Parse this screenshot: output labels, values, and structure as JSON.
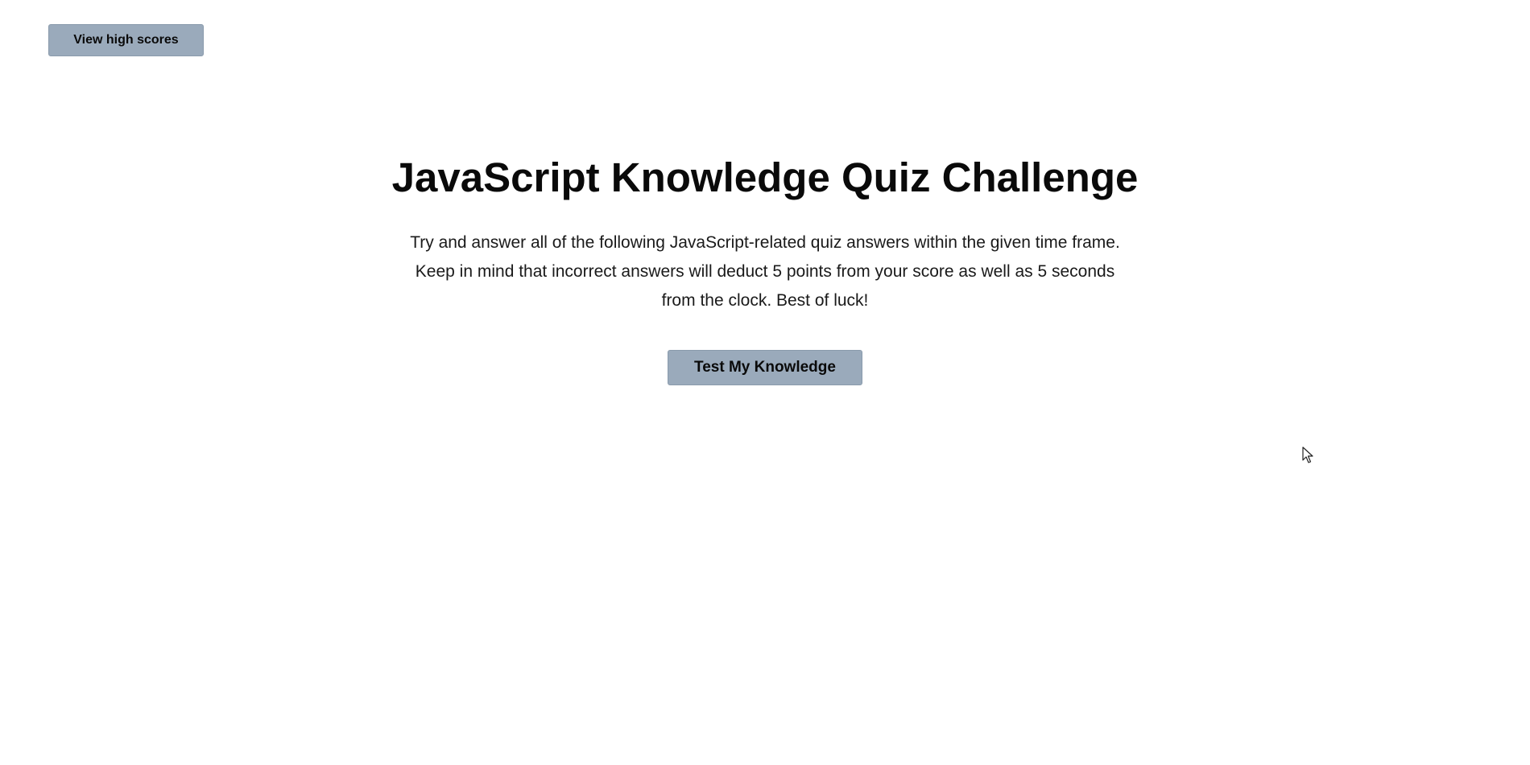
{
  "header": {
    "high_scores_label": "View high scores"
  },
  "main": {
    "title": "JavaScript Knowledge Quiz Challenge",
    "description": "Try and answer all of the following JavaScript-related quiz answers within the given time frame. Keep in mind that incorrect answers will deduct 5 points from your score as well as 5 seconds from the clock. Best of luck!",
    "start_label": "Test My Knowledge"
  },
  "colors": {
    "button_bg": "#9aaabb",
    "text": "#0a0a0a",
    "background": "#ffffff"
  },
  "icons": {
    "cursor": "mouse-pointer-icon"
  }
}
